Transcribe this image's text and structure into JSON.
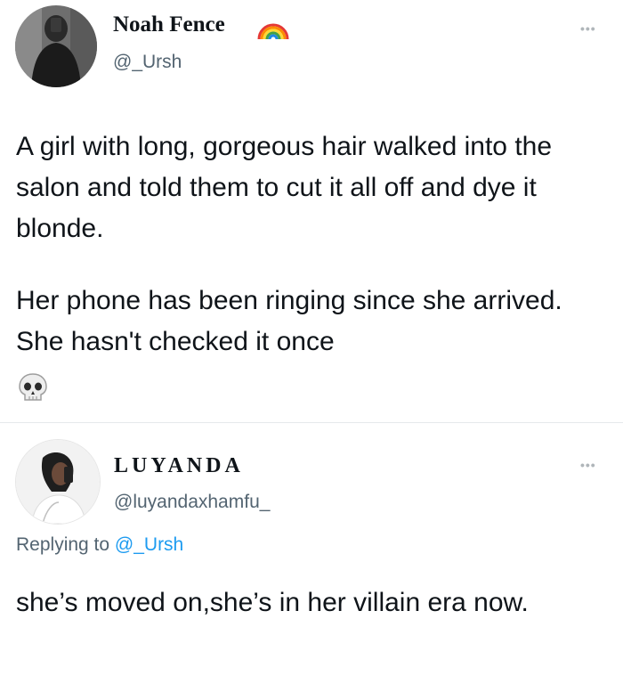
{
  "tweet1": {
    "name": "Noah Fence",
    "name_emoji_icon": "rainbow-icon",
    "handle": "@_Ursh",
    "more_label": "•••",
    "paragraph1": "A girl with long, gorgeous hair walked into the salon and told them to cut it all off and dye it blonde.",
    "paragraph2": "Her phone has been ringing since she arrived. She hasn't checked it once",
    "emoji_icon": "skull-icon"
  },
  "tweet2": {
    "name": "LUYANDA",
    "handle": "@luyandaxhamfu_",
    "more_label": "•••",
    "replying_prefix": "Replying to",
    "replying_mention": "@_Ursh",
    "text": "she’s moved on,she’s in her villain era now."
  }
}
